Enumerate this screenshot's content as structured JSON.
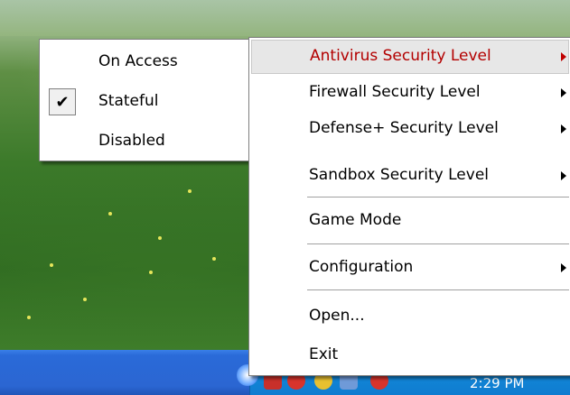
{
  "submenu": {
    "items": [
      {
        "label": "On Access",
        "checked": false
      },
      {
        "label": "Stateful",
        "checked": true
      },
      {
        "label": "Disabled",
        "checked": false
      }
    ],
    "check_glyph": "✔"
  },
  "menu": {
    "items": [
      {
        "label": "Antivirus Security Level",
        "has_submenu": true,
        "highlighted": true
      },
      {
        "label": "Firewall Security Level",
        "has_submenu": true
      },
      {
        "label": "Defense+ Security Level",
        "has_submenu": true
      },
      {
        "label": "Sandbox Security Level",
        "has_submenu": true
      },
      {
        "label": "Game Mode",
        "has_submenu": false
      },
      {
        "label": "Configuration",
        "has_submenu": true
      },
      {
        "label": "Open...",
        "has_submenu": false
      },
      {
        "label": "Exit",
        "has_submenu": false
      }
    ],
    "highlight_text_color": "#b30000"
  },
  "taskbar": {
    "clock": "2:29 PM",
    "tray_icons": [
      "comodo-icon",
      "shield-icon",
      "network-icon",
      "security-alert-icon",
      "firewall-icon"
    ]
  }
}
